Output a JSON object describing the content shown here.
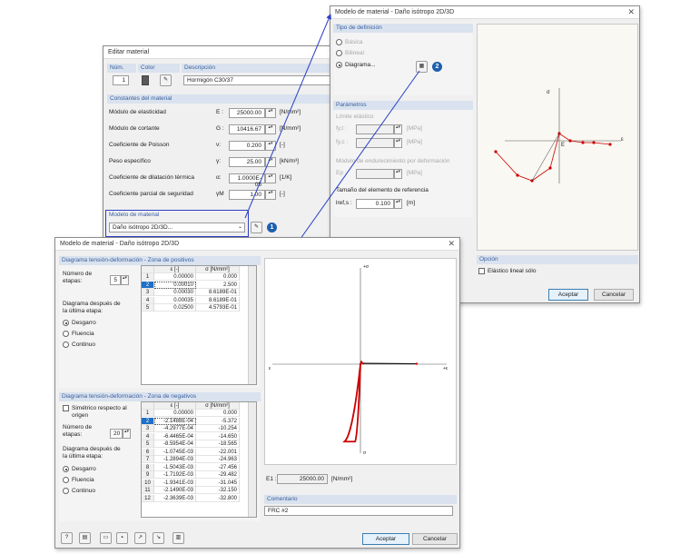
{
  "win_editar": {
    "title": "Editar material",
    "num_label": "Núm.",
    "num_value": "1",
    "color_label": "Color",
    "desc_label": "Descripción",
    "desc_value": "Hormigón C30/37",
    "constants_header": "Constantes del material",
    "constants": [
      {
        "label": "Módulo de elasticidad",
        "symbol": "E :",
        "value": "25000.00",
        "unit": "[N/mm²]"
      },
      {
        "label": "Módulo de cortante",
        "symbol": "G :",
        "value": "10416.67",
        "unit": "[N/mm²]"
      },
      {
        "label": "Coeficiente de Poisson",
        "symbol": "ν:",
        "value": "0.200",
        "unit": "[-]"
      },
      {
        "label": "Peso específico",
        "symbol": "γ:",
        "value": "25.00",
        "unit": "[kN/m³]"
      },
      {
        "label": "Coeficiente de dilatación térmica",
        "symbol": "α:",
        "value": "1.0000E-05",
        "unit": "[1/K]"
      },
      {
        "label": "Coeficiente parcial de seguridad",
        "symbol": "γM",
        "value": "1.00",
        "unit": "[-]"
      }
    ],
    "model_label": "Modelo de material",
    "model_value": "Daño isótropo 2D/3D...",
    "badge": "1"
  },
  "win_dano_top": {
    "title": "Modelo de material - Daño isótropo 2D/3D",
    "def_type_header": "Tipo de definición",
    "options": [
      "Básica",
      "Bilineal",
      "Diagrama..."
    ],
    "badge": "2",
    "params_header": "Parámetros",
    "limit_label": "Límite elástico",
    "fy1_label": "fy,t :",
    "fy2_label": "fy,c :",
    "unit_mpa": "[MPa]",
    "hardening_label": "Módulo de endurecimiento por deformación",
    "ep_label": "Ep :",
    "element_size_label": "Tamaño del elemento de referencia",
    "lref_label": "lref,s :",
    "lref_value": "0.100",
    "unit_m": "[m]",
    "axis_sigma": "σ",
    "axis_e": "E",
    "axis_eps": "ε",
    "option_header": "Opción",
    "elastic_only": "Elástico lineal sólo",
    "accept": "Aceptar",
    "cancel": "Cancelar"
  },
  "win_main": {
    "title": "Modelo de material - Daño isótropo 2D/3D",
    "pos_header": "Diagrama tensión-deformación - Zona de positivos",
    "steps_label": "Número de etapas:",
    "pos_steps": "5",
    "after_label": "Diagrama después de la última etapa:",
    "after_options": [
      "Desgarro",
      "Fluencia",
      "Continuo"
    ],
    "col_eps": "ε [-]",
    "col_sigma": "σ [N/mm²]",
    "pos_rows": [
      {
        "n": "1",
        "eps": "0.00000",
        "sig": "0.000"
      },
      {
        "n": "2",
        "eps": "0.00010",
        "sig": "2.500"
      },
      {
        "n": "3",
        "eps": "0.00030",
        "sig": "8.6189E-01"
      },
      {
        "n": "4",
        "eps": "0.00035",
        "sig": "8.6189E-01"
      },
      {
        "n": "5",
        "eps": "0.02500",
        "sig": "4.5793E-01"
      }
    ],
    "neg_header": "Diagrama tensión-deformación - Zona de negativos",
    "symmetric_label": "Simétrico respecto al origen",
    "neg_steps": "20",
    "neg_rows": [
      {
        "n": "1",
        "eps": "0.00000",
        "sig": "0.000"
      },
      {
        "n": "2",
        "eps": "-2.1488E-04",
        "sig": "-5.372"
      },
      {
        "n": "3",
        "eps": "-4.2977E-04",
        "sig": "-10.254"
      },
      {
        "n": "4",
        "eps": "-6.4465E-04",
        "sig": "-14.650"
      },
      {
        "n": "5",
        "eps": "-8.5954E-04",
        "sig": "-18.565"
      },
      {
        "n": "6",
        "eps": "-1.0745E-03",
        "sig": "-22.001"
      },
      {
        "n": "7",
        "eps": "-1.2894E-03",
        "sig": "-24.963"
      },
      {
        "n": "8",
        "eps": "-1.5043E-03",
        "sig": "-27.456"
      },
      {
        "n": "9",
        "eps": "-1.7192E-03",
        "sig": "-29.482"
      },
      {
        "n": "10",
        "eps": "-1.9341E-03",
        "sig": "-31.045"
      },
      {
        "n": "11",
        "eps": "-2.1490E-03",
        "sig": "-32.150"
      },
      {
        "n": "12",
        "eps": "-2.3639E-03",
        "sig": "-32.800"
      }
    ],
    "axis_sigma": "+σ",
    "axis_eps_pos": "+ε",
    "axis_eps_neg": "ε",
    "axis_sigma_neg": "σ",
    "e1_label": "E1 :",
    "e1_value": "25000.00",
    "e1_unit": "[N/mm²]",
    "comment_label": "Comentario",
    "comment_value": "FRC #2",
    "accept": "Aceptar",
    "cancel": "Cancelar"
  },
  "colors": {
    "accent": "#1e5fae",
    "curve": "#cc0000",
    "arrow": "#2a3fc4"
  }
}
